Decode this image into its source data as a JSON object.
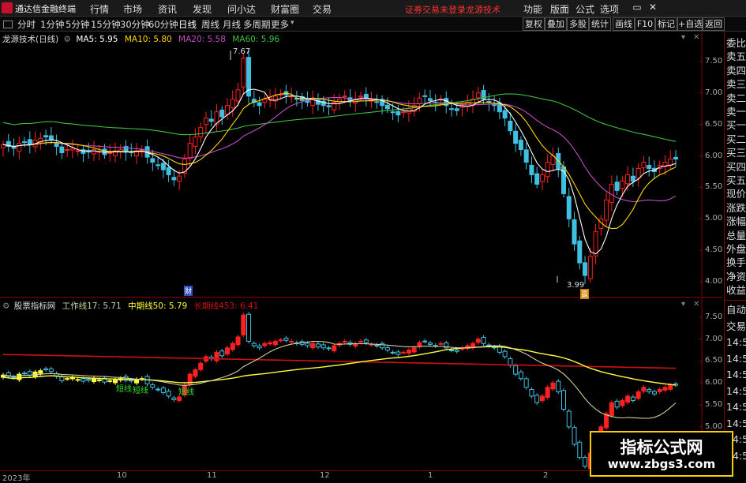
{
  "app": {
    "title": "通达信金融终端"
  },
  "menu": [
    "行情",
    "市场",
    "资讯",
    "发现",
    "问小达",
    "财富圈",
    "交易"
  ],
  "status": {
    "trade_notice": "证券交易未登录",
    "brand": "龙源技术"
  },
  "toolbar": [
    "功能",
    "版面",
    "公式",
    "选项"
  ],
  "window_buttons": {
    "restore": "▭",
    "close": "✕"
  },
  "periods": [
    "分时",
    "1分钟",
    "5分钟",
    "15分钟",
    "30分钟",
    "60分钟",
    "日线",
    "周线",
    "月线",
    "多周期",
    "更多"
  ],
  "period_active": "日线",
  "right_buttons": [
    "复权",
    "叠加",
    "多股",
    "统计",
    "画线",
    "F10",
    "标记",
    "+自选",
    "返回"
  ],
  "main_legend": {
    "name": "龙源技术(日线)",
    "ma5": "MA5: 5.95",
    "ma10": "MA10: 5.80",
    "ma20": "MA20: 5.58",
    "ma60": "MA60: 5.96"
  },
  "sub_legend": {
    "name": "股票指标网",
    "work": "工作线17: 5.71",
    "mid": "中期线50: 5.79",
    "long": "长期线453: 6.41"
  },
  "annotations": {
    "high": "7.67",
    "low": "3.99",
    "cai": "财",
    "ying": "赢"
  },
  "signals": [
    "短线",
    "短线",
    "短线"
  ],
  "colors": {
    "up": "#ff2020",
    "down": "#40c0e0",
    "ma5": "#ffffff",
    "ma10": "#ffd700",
    "ma20": "#c050c0",
    "ma60": "#40c040",
    "long": "#d01010",
    "mid": "#ffff40",
    "work": "#d0d0a0"
  },
  "right_panel": {
    "top": [
      "委比",
      "卖五",
      "卖四",
      "卖三",
      "卖二",
      "卖一",
      "买一",
      "买二",
      "买三",
      "买四",
      "买五",
      "现价",
      "涨跌",
      "涨幅",
      "总量",
      "外盘",
      "换手",
      "净资",
      "收益"
    ],
    "bottom": [
      "自动",
      "交易",
      "14:5",
      "14:5",
      "14:5",
      "14:5",
      "14:5",
      "14:5",
      "14:5",
      "14:5"
    ]
  },
  "watermark": {
    "title": "指标公式网",
    "url": "www.zbgs3.com"
  },
  "chart_data": [
    {
      "type": "candlestick",
      "title": "龙源技术(日线)",
      "yticks": [
        "7.50",
        "7.00",
        "6.50",
        "6.00",
        "5.50",
        "5.00",
        "4.50",
        "4.00"
      ],
      "ylim": [
        3.9,
        7.85
      ],
      "xticks": [
        "2023年",
        "10",
        "11",
        "12",
        "1",
        "2"
      ],
      "high_mark": 7.67,
      "low_mark": 3.99,
      "close": [
        6.18,
        6.15,
        6.12,
        6.2,
        6.22,
        6.18,
        6.25,
        6.28,
        6.3,
        6.26,
        6.15,
        6.05,
        6.1,
        6.12,
        6.08,
        6.04,
        6.06,
        6.1,
        6.07,
        6.02,
        6.05,
        6.08,
        6.1,
        6.06,
        6.05,
        6.08,
        6.1,
        5.98,
        5.9,
        5.85,
        5.78,
        5.7,
        5.62,
        5.68,
        5.95,
        6.2,
        6.3,
        6.45,
        6.6,
        6.55,
        6.7,
        6.62,
        6.8,
        6.9,
        7.05,
        7.55,
        6.95,
        6.85,
        6.8,
        6.9,
        6.92,
        6.95,
        6.98,
        6.97,
        6.95,
        6.9,
        6.88,
        6.85,
        6.9,
        6.82,
        6.8,
        6.78,
        6.85,
        6.9,
        6.95,
        6.88,
        6.9,
        6.95,
        6.92,
        6.88,
        6.85,
        6.8,
        6.75,
        6.7,
        6.65,
        6.7,
        6.75,
        6.8,
        6.92,
        6.95,
        6.88,
        6.85,
        6.9,
        6.8,
        6.75,
        6.72,
        6.8,
        6.85,
        6.9,
        7.0,
        6.9,
        6.85,
        6.8,
        6.7,
        6.6,
        6.4,
        6.2,
        6.1,
        5.9,
        5.7,
        5.55,
        5.7,
        5.9,
        6.0,
        5.8,
        5.4,
        5.0,
        4.6,
        4.3,
        4.1,
        4.4,
        4.8,
        5.0,
        5.3,
        5.55,
        5.45,
        5.6,
        5.7,
        5.6,
        5.8,
        5.9,
        5.8,
        5.75,
        5.85,
        5.9,
        5.95,
        5.95
      ],
      "ma5": "5.95",
      "ma10": "5.80",
      "ma20": "5.58",
      "ma60": "5.96"
    },
    {
      "type": "indicator",
      "title": "股票指标网",
      "yticks": [
        "7.50",
        "7.00",
        "6.50",
        "6.00",
        "5.50",
        "5.00",
        "4.50"
      ],
      "ylim": [
        4.15,
        7.75
      ],
      "series": [
        {
          "name": "工作线17",
          "last": 5.71
        },
        {
          "name": "中期线50",
          "last": 5.79
        },
        {
          "name": "长期线453",
          "last": 6.41
        }
      ]
    }
  ]
}
